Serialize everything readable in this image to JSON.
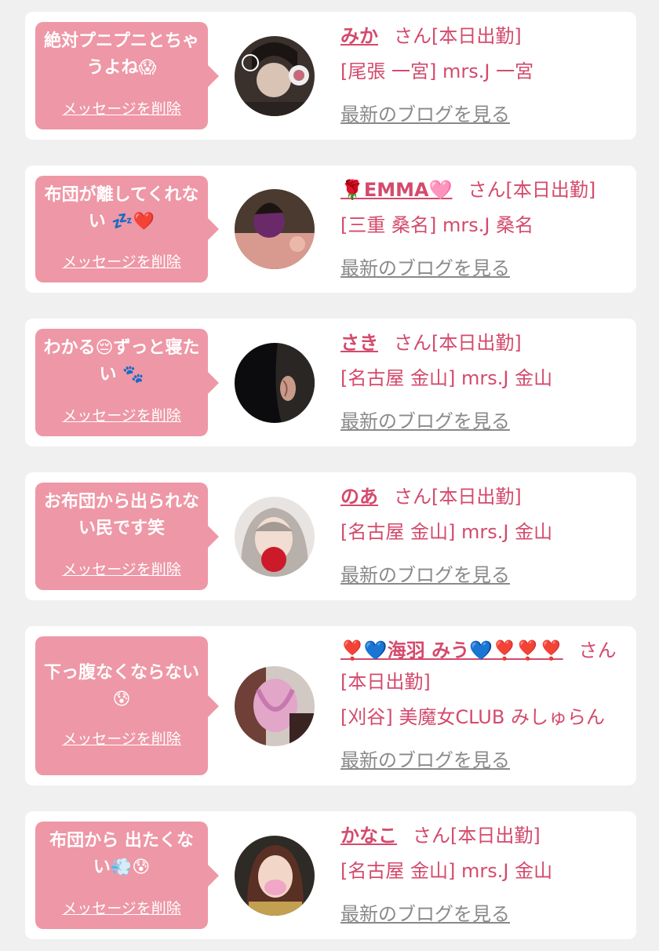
{
  "colors": {
    "accent": "#d44a6c",
    "bubble": "#ee97a6",
    "link_gray": "#8a8a8a",
    "background": "#f0f0f0"
  },
  "cards": [
    {
      "message": "絶対プニプニとちゃうよね😱",
      "delete_label": "メッセージを削除",
      "name": "みか",
      "suffix": "さん[本日出勤]",
      "shop": "[尾張 一宮] mrs.J 一宮",
      "blog_label": "最新のブログを見る"
    },
    {
      "message": "布団が離してくれない 💤❤️",
      "delete_label": "メッセージを削除",
      "name": "🌹EMMA🩷",
      "suffix": "さん[本日出勤]",
      "shop": "[三重 桑名] mrs.J 桑名",
      "blog_label": "最新のブログを見る"
    },
    {
      "message": "わかる😔ずっと寝たい 🐾",
      "delete_label": "メッセージを削除",
      "name": "さき",
      "suffix": "さん[本日出勤]",
      "shop": "[名古屋 金山] mrs.J 金山",
      "blog_label": "最新のブログを見る"
    },
    {
      "message": "お布団から出られない民です笑",
      "delete_label": "メッセージを削除",
      "name": "のあ",
      "suffix": "さん[本日出勤]",
      "shop": "[名古屋 金山] mrs.J 金山",
      "blog_label": "最新のブログを見る"
    },
    {
      "message": "下っ腹なくならない😰",
      "delete_label": "メッセージを削除",
      "name": "❣️💙海羽 みう💙❣️❣️❣️",
      "suffix": "さん",
      "status": "[本日出勤]",
      "shop": "[刈谷] 美魔女CLUB みしゅらん",
      "blog_label": "最新のブログを見る"
    },
    {
      "message": "布団から 出たくない💨😰",
      "delete_label": "メッセージを削除",
      "name": "かなこ",
      "suffix": "さん[本日出勤]",
      "shop": "[名古屋 金山] mrs.J 金山",
      "blog_label": "最新のブログを見る"
    }
  ]
}
